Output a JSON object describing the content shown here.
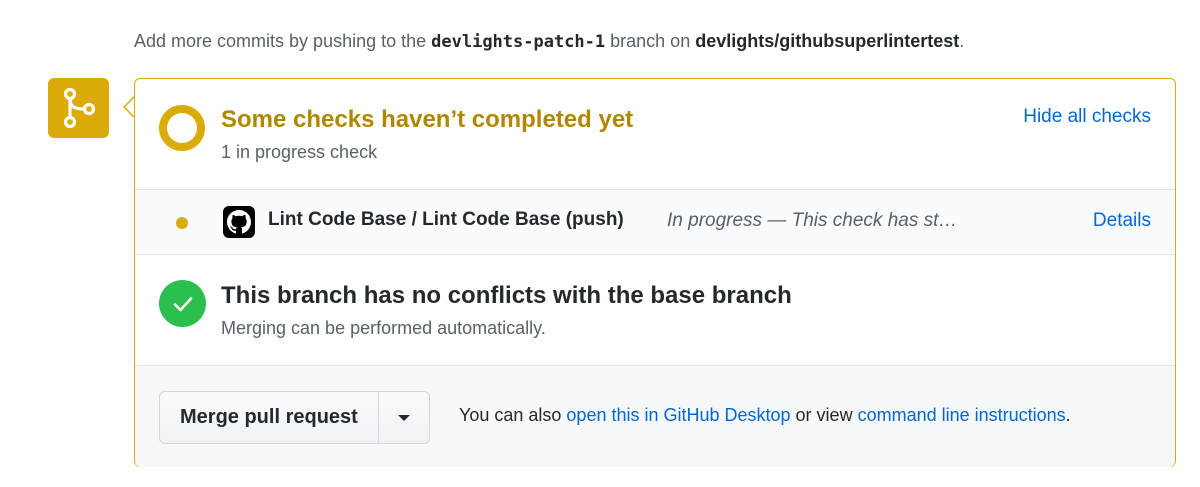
{
  "hint": {
    "prefix": "Add more commits by pushing to the ",
    "branch": "devlights-patch-1",
    "middle": " branch on ",
    "repo": "devlights/githubsuperlintertest",
    "suffix": "."
  },
  "checks": {
    "title": "Some checks haven’t completed yet",
    "subtitle": "1 in progress check",
    "toggle_label": "Hide all checks",
    "items": [
      {
        "name": "Lint Code Base / Lint Code Base (push)",
        "status": "In progress — This check has st…",
        "details_label": "Details"
      }
    ]
  },
  "conflicts": {
    "title": "This branch has no conflicts with the base branch",
    "subtitle": "Merging can be performed automatically."
  },
  "merge": {
    "button_label": "Merge pull request",
    "note_prefix": "You can also ",
    "desktop_link": "open this in GitHub Desktop",
    "note_middle": " or view ",
    "cli_link": "command line instructions",
    "note_suffix": "."
  },
  "colors": {
    "pending": "#dbab09",
    "pending_text": "#b08800",
    "success": "#2cbe4e",
    "link": "#0366d6"
  },
  "icons": {
    "merge_status": "git-merge-icon",
    "check_app": "github-logo-icon",
    "success": "check-icon",
    "dropdown": "triangle-down-icon"
  }
}
